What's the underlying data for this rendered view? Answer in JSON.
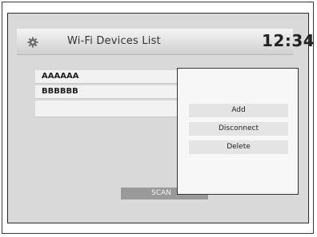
{
  "header": {
    "title": "Wi-Fi Devices List",
    "clock": "12:34",
    "icon": "gear-icon"
  },
  "devices": [
    {
      "name": "AAAAAA"
    },
    {
      "name": "BBBBBB"
    },
    {
      "name": ""
    }
  ],
  "footer": {
    "scan_label": "SCAN"
  },
  "context_menu": {
    "items": [
      {
        "label": "Add"
      },
      {
        "label": "Disconnect"
      },
      {
        "label": "Delete"
      }
    ]
  }
}
